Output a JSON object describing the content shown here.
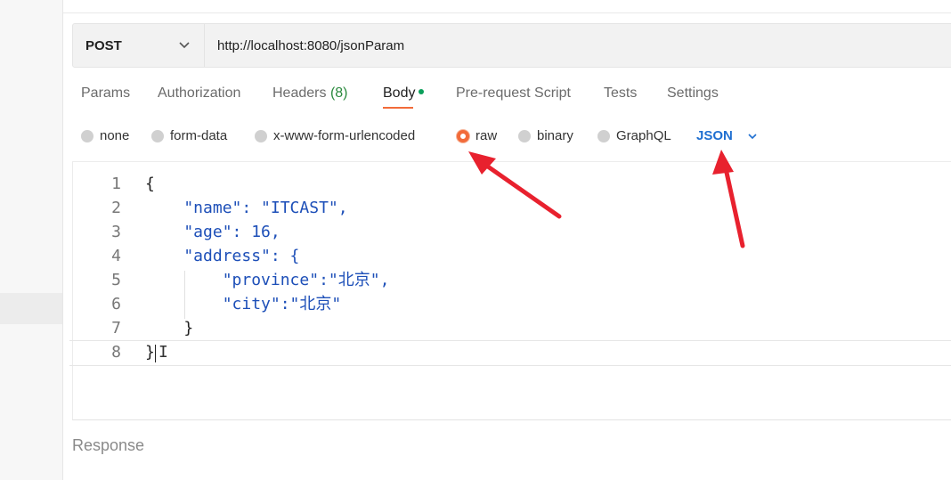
{
  "request": {
    "method": "POST",
    "url": "http://localhost:8080/jsonParam"
  },
  "tabs": [
    {
      "label": "Params"
    },
    {
      "label": "Authorization"
    },
    {
      "label": "Headers",
      "count": "(8)"
    },
    {
      "label": "Body",
      "active": true
    },
    {
      "label": "Pre-request Script"
    },
    {
      "label": "Tests"
    },
    {
      "label": "Settings"
    }
  ],
  "body_types": {
    "options": [
      {
        "label": "none"
      },
      {
        "label": "form-data"
      },
      {
        "label": "x-www-form-urlencoded"
      },
      {
        "label": "raw",
        "selected": true
      },
      {
        "label": "binary"
      },
      {
        "label": "GraphQL"
      }
    ],
    "language": "JSON"
  },
  "editor": {
    "line_numbers": [
      "1",
      "2",
      "3",
      "4",
      "5",
      "6",
      "7",
      "8"
    ],
    "lines": [
      "{",
      "    \"name\": \"ITCAST\",",
      "    \"age\": 16,",
      "    \"address\": {",
      "        \"province\":\"北京\",",
      "        \"city\":\"北京\"",
      "    }",
      "}"
    ]
  },
  "response": {
    "label": "Response"
  },
  "colors": {
    "accent": "#f26b3a",
    "link": "#1f6fd1",
    "annotation_arrow": "#e8212e"
  }
}
